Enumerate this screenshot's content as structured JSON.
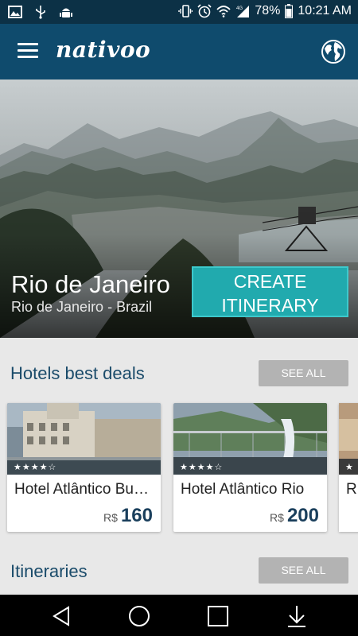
{
  "status_bar": {
    "icons_left": [
      "image-icon",
      "usb-icon",
      "android-debug-icon"
    ],
    "icons_right": [
      "vibrate-icon",
      "alarm-icon",
      "wifi-icon",
      "signal-4g-icon",
      "battery-icon"
    ],
    "network": "4G",
    "battery": "78%",
    "time": "10:21 AM"
  },
  "app_bar": {
    "logo": "nativoo",
    "menu_icon": "hamburger-menu-icon",
    "globe_icon": "globe-icon"
  },
  "hero": {
    "city": "Rio de Janeiro",
    "subtitle": "Rio de Janeiro - Brazil",
    "cta_line1": "CREATE",
    "cta_line2": "ITINERARY"
  },
  "hotels_section": {
    "title": "Hotels best deals",
    "see_all": "SEE ALL",
    "hotels": [
      {
        "name": "Hotel Atlântico Bu…",
        "stars": 4,
        "currency": "R$",
        "price": "160"
      },
      {
        "name": "Hotel Atlântico Rio",
        "stars": 4,
        "currency": "R$",
        "price": "200"
      },
      {
        "name": "R",
        "stars": 1,
        "currency": "",
        "price": ""
      }
    ]
  },
  "itineraries_section": {
    "title": "Itineraries",
    "see_all": "SEE ALL"
  },
  "nav_bar": {
    "buttons": [
      "back-icon",
      "home-icon",
      "recents-icon",
      "download-icon"
    ]
  },
  "colors": {
    "status_bar": "#0c3146",
    "app_bar": "#0f4b6d",
    "accent": "#21aaae",
    "section_title": "#1a4b6a",
    "see_all_bg": "#b3b3b3"
  }
}
